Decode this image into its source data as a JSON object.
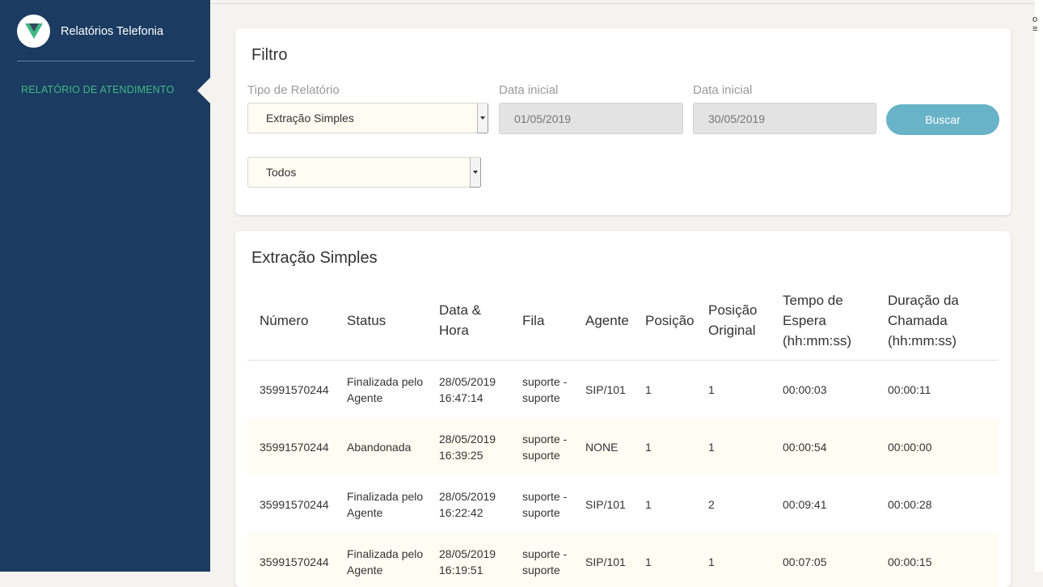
{
  "app": {
    "title": "Relatórios Telefonia",
    "logo_icon": "vue-logo-icon",
    "accent_color": "#41b883",
    "sidebar_color": "#1b3b62"
  },
  "sidebar": {
    "items": [
      {
        "label": "RELATÓRIO DE ATENDIMENTO",
        "active": true
      }
    ]
  },
  "filter": {
    "title": "Filtro",
    "report_type_label": "Tipo de Relatório",
    "report_type_value": "Extração Simples",
    "start_date_label": "Data inicial",
    "start_date_value": "01/05/2019",
    "end_date_label": "Data inicial",
    "end_date_value": "30/05/2019",
    "search_label": "Buscar",
    "status_filter_value": "Todos"
  },
  "results": {
    "title": "Extração Simples",
    "columns": [
      "Número",
      "Status",
      "Data & Hora",
      "Fila",
      "Agente",
      "Posição",
      "Posição Original",
      "Tempo de Espera (hh:mm:ss)",
      "Duração da Chamada (hh:mm:ss)"
    ],
    "rows": [
      [
        "35991570244",
        "Finalizada pelo Agente",
        "28/05/2019 16:47:14",
        "suporte - suporte",
        "SIP/101",
        "1",
        "1",
        "00:00:03",
        "00:00:11"
      ],
      [
        "35991570244",
        "Abandonada",
        "28/05/2019 16:39:25",
        "suporte - suporte",
        "NONE",
        "1",
        "1",
        "00:00:54",
        "00:00:00"
      ],
      [
        "35991570244",
        "Finalizada pelo Agente",
        "28/05/2019 16:22:42",
        "suporte - suporte",
        "SIP/101",
        "1",
        "2",
        "00:09:41",
        "00:00:28"
      ],
      [
        "35991570244",
        "Finalizada pelo Agente",
        "28/05/2019 16:19:51",
        "suporte - suporte",
        "SIP/101",
        "1",
        "1",
        "00:07:05",
        "00:00:15"
      ]
    ]
  }
}
